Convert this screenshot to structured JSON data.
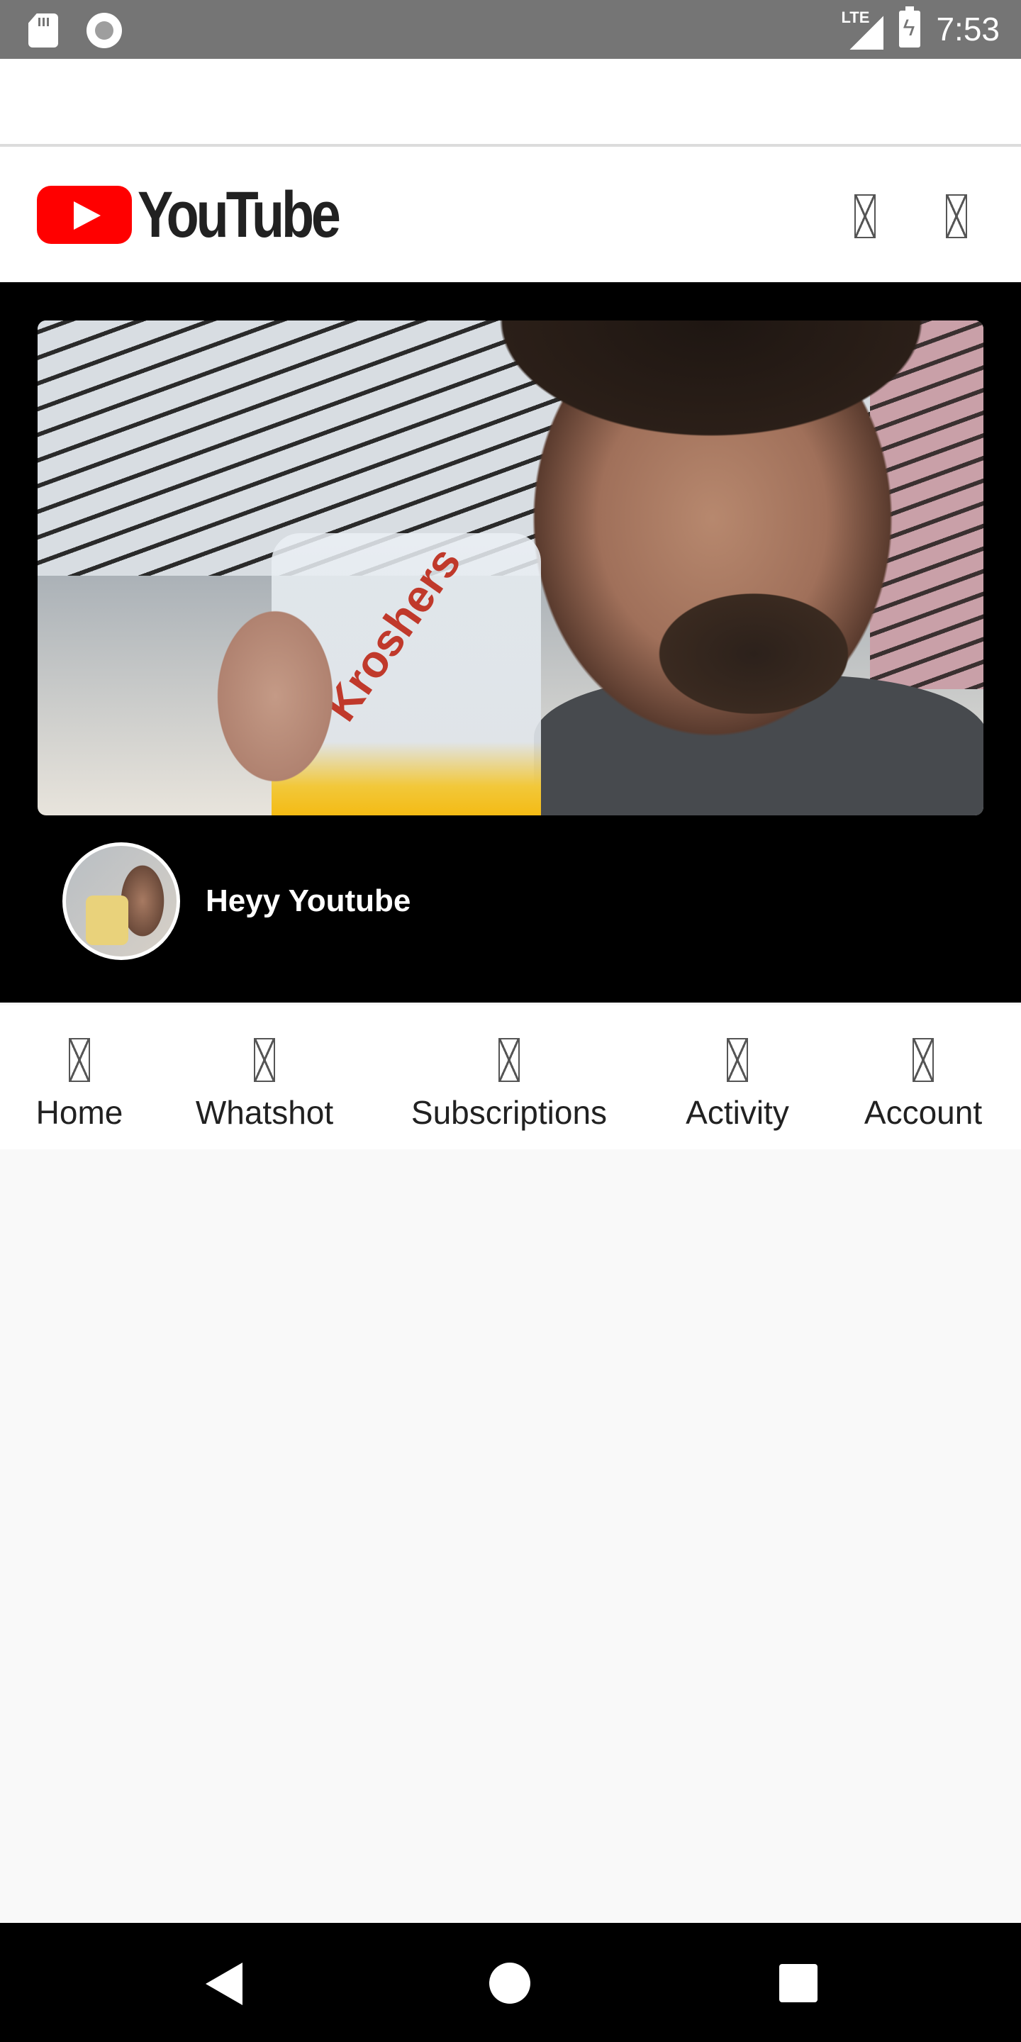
{
  "status_bar": {
    "network": "LTE",
    "time": "7:53"
  },
  "header": {
    "logo_text": "YouTube",
    "brand_color": "#ff0000",
    "icons": [
      "search-icon",
      "account-icon"
    ]
  },
  "featured": {
    "channel_title": "Heyy Youtube",
    "thumbnail_cup_text": "Kroshers"
  },
  "bottom_nav": {
    "items": [
      {
        "label": "Home",
        "icon": "home-icon"
      },
      {
        "label": "Whatshot",
        "icon": "whatshot-icon"
      },
      {
        "label": "Subscriptions",
        "icon": "subscriptions-icon"
      },
      {
        "label": "Activity",
        "icon": "activity-icon"
      },
      {
        "label": "Account",
        "icon": "account-icon"
      }
    ]
  }
}
